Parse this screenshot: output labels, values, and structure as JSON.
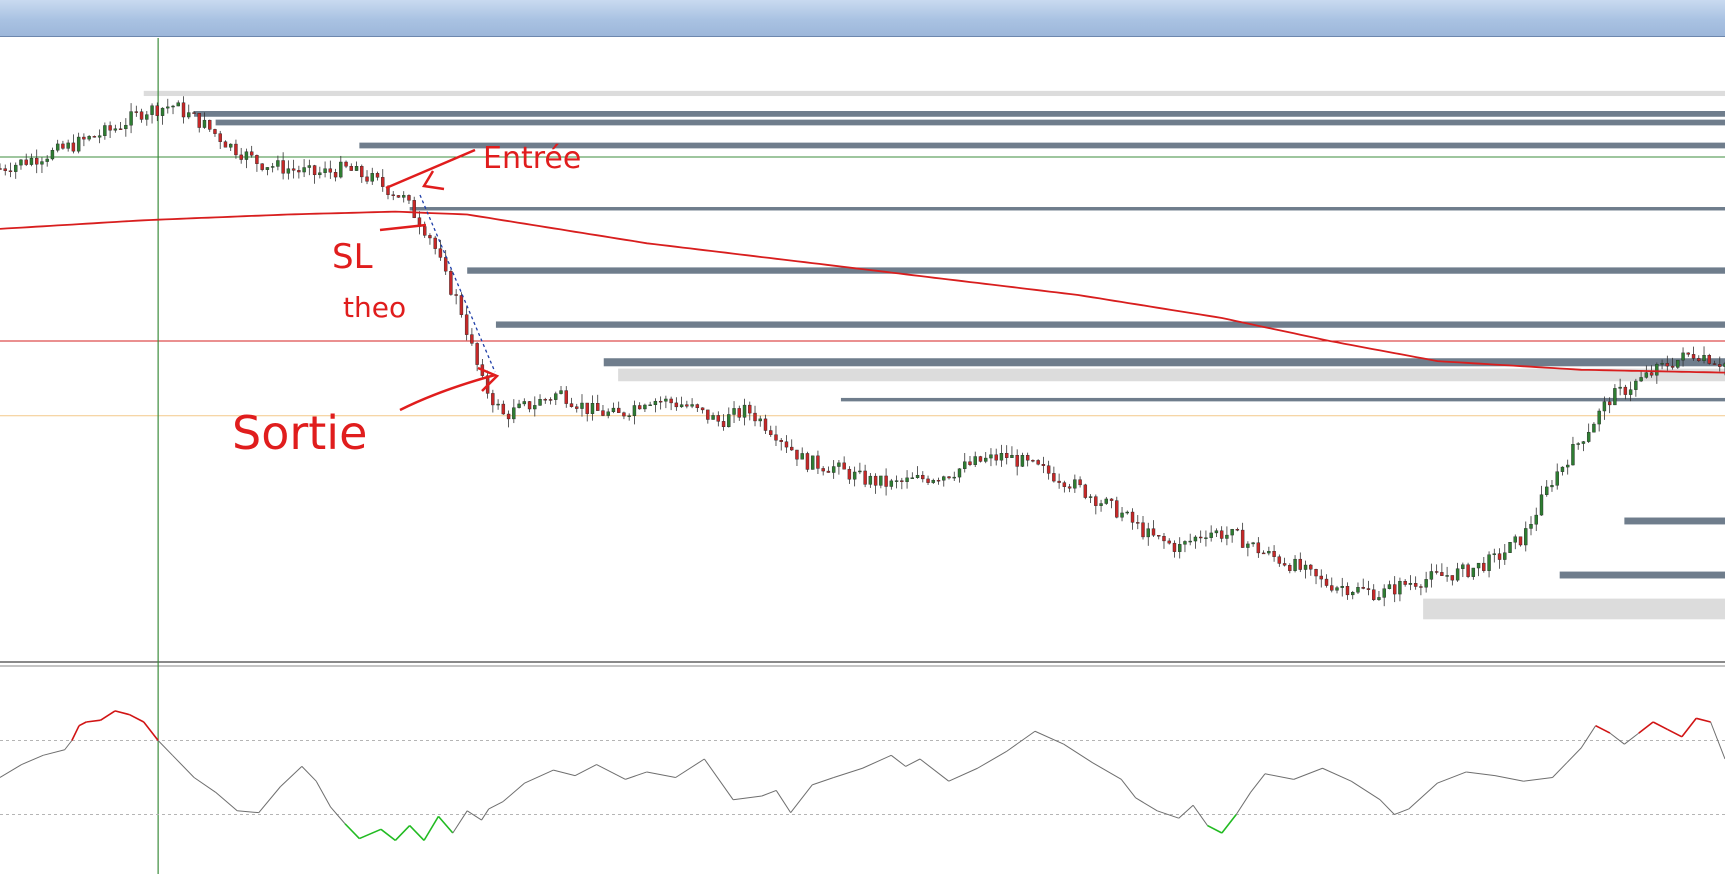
{
  "window": {
    "title": ""
  },
  "colors": {
    "zone_dark": "#6f7d8c",
    "zone_light": "#dcdcdc",
    "moving_average": "#d81e1e",
    "candle_bull": "#2e7d32",
    "candle_bear": "#c62828",
    "grid_green": "#3c8c3c",
    "grid_red": "#d62020",
    "osc_neutral": "#6e6e6e",
    "osc_overbought": "#d11414",
    "osc_oversold": "#22bb22",
    "annotation": "#e01d1d"
  },
  "annotations": {
    "entry": "Entrée",
    "stop_loss_line1": "SL",
    "stop_loss_line2": "theo",
    "exit": "Sortie"
  },
  "chart_data": [
    {
      "type": "line",
      "title": "",
      "subtitle": "",
      "xlabel": "",
      "ylabel": "",
      "instrument": "price (candlestick)",
      "x_index_range": [
        0,
        240
      ],
      "ylim": [
        0,
        100
      ],
      "grid": false,
      "legend": "none",
      "price_path": {
        "x": [
          0,
          8,
          16,
          20,
          24,
          28,
          32,
          36,
          40,
          44,
          48,
          52,
          56,
          60,
          62,
          64,
          67,
          70,
          74,
          78,
          82,
          86,
          90,
          95,
          100,
          104,
          108,
          112,
          116,
          120,
          124,
          128,
          132,
          136,
          140,
          144,
          148,
          152,
          156,
          160,
          164,
          168,
          172,
          176,
          180,
          184,
          188,
          192,
          196,
          200,
          204,
          208,
          212,
          216,
          220,
          224,
          228,
          232,
          236,
          240
        ],
        "y": [
          82,
          85,
          89,
          92,
          93,
          90,
          86,
          83,
          82,
          81,
          82,
          80,
          77,
          70,
          63,
          58,
          45,
          39,
          41,
          43,
          40,
          39,
          42,
          41,
          38,
          40,
          36,
          31,
          30,
          28,
          27,
          28,
          29,
          31,
          32,
          30,
          28,
          25,
          22,
          18,
          16,
          19,
          18,
          15,
          13,
          10,
          9,
          8,
          10,
          11,
          12,
          14,
          18,
          28,
          35,
          42,
          45,
          48,
          50,
          48
        ]
      },
      "moving_average": {
        "x": [
          0,
          20,
          40,
          55,
          65,
          75,
          90,
          110,
          130,
          150,
          170,
          185,
          200,
          220,
          240
        ],
        "y": [
          71.5,
          73,
          74,
          74.5,
          74,
          72,
          69,
          66,
          63,
          60,
          56,
          52,
          48.5,
          47,
          46.5
        ]
      },
      "horizontal_lines": [
        {
          "color": "green",
          "y": 84
        },
        {
          "color": "red",
          "y": 52
        },
        {
          "color": "orange",
          "y": 39
        }
      ],
      "vertical_line_x": 22,
      "zones": [
        {
          "tone": "light",
          "x_start": 20,
          "y_top": 95.5,
          "y_bottom": 94.6
        },
        {
          "tone": "dark",
          "x_start": 27,
          "y_top": 92,
          "y_bottom": 91
        },
        {
          "tone": "dark",
          "x_start": 30,
          "y_top": 90.5,
          "y_bottom": 89.5
        },
        {
          "tone": "dark",
          "x_start": 50,
          "y_top": 86.5,
          "y_bottom": 85.5
        },
        {
          "tone": "dark",
          "x_start": 57,
          "y_top": 75.3,
          "y_bottom": 74.7
        },
        {
          "tone": "dark",
          "x_start": 65,
          "y_top": 64.8,
          "y_bottom": 63.7
        },
        {
          "tone": "dark",
          "x_start": 69,
          "y_top": 55.4,
          "y_bottom": 54.3
        },
        {
          "tone": "dark",
          "x_start": 84,
          "y_top": 49,
          "y_bottom": 47.6
        },
        {
          "tone": "light",
          "x_start": 86,
          "y_top": 47.2,
          "y_bottom": 45
        },
        {
          "tone": "dark",
          "x_start": 117,
          "y_top": 42.1,
          "y_bottom": 41.5
        },
        {
          "tone": "dark",
          "x_start": 226,
          "y_top": 21.3,
          "y_bottom": 20.1
        },
        {
          "tone": "dark",
          "x_start": 217,
          "y_top": 11.9,
          "y_bottom": 10.7
        },
        {
          "tone": "light",
          "x_start": 198,
          "y_top": 7.2,
          "y_bottom": 3.6
        }
      ]
    },
    {
      "type": "line",
      "title": "",
      "xlabel": "",
      "ylabel": "",
      "instrument": "oscillator",
      "ylim": [
        0,
        100
      ],
      "levels": [
        70,
        30
      ],
      "grid": false,
      "legend": "none",
      "x": [
        0,
        3,
        6,
        9,
        10,
        11,
        12,
        14,
        16,
        18,
        20,
        22,
        24,
        27,
        30,
        33,
        36,
        39,
        42,
        44,
        46,
        48,
        50,
        53,
        55,
        57,
        59,
        61,
        63,
        65,
        67,
        68,
        70,
        73,
        77,
        80,
        83,
        87,
        90,
        94,
        98,
        102,
        106,
        108,
        110,
        113,
        116,
        120,
        124,
        126,
        128,
        132,
        136,
        140,
        144,
        148,
        152,
        156,
        158,
        161,
        164,
        166,
        168,
        170,
        172,
        174,
        176,
        180,
        184,
        188,
        192,
        194,
        196,
        200,
        204,
        208,
        212,
        216,
        218,
        220,
        222,
        224,
        226,
        228,
        230,
        232,
        234,
        236,
        238,
        240
      ],
      "y": [
        50,
        57,
        62,
        65,
        70,
        78,
        80,
        81,
        86,
        84,
        80,
        70,
        62,
        50,
        42,
        32,
        31,
        45,
        56,
        48,
        34,
        25,
        17,
        22,
        16,
        24,
        16,
        29,
        20,
        32,
        27,
        33,
        37,
        47,
        54,
        51,
        57,
        49,
        53,
        50,
        60,
        38,
        40,
        43,
        31,
        46,
        50,
        55,
        62,
        56,
        60,
        48,
        55,
        64,
        75,
        68,
        58,
        49,
        39,
        32,
        28,
        35,
        24,
        20,
        30,
        42,
        52,
        49,
        55,
        48,
        38,
        30,
        33,
        47,
        53,
        51,
        48,
        50,
        58,
        66,
        78,
        74,
        68,
        74,
        80,
        76,
        72,
        82,
        80,
        60
      ]
    }
  ]
}
